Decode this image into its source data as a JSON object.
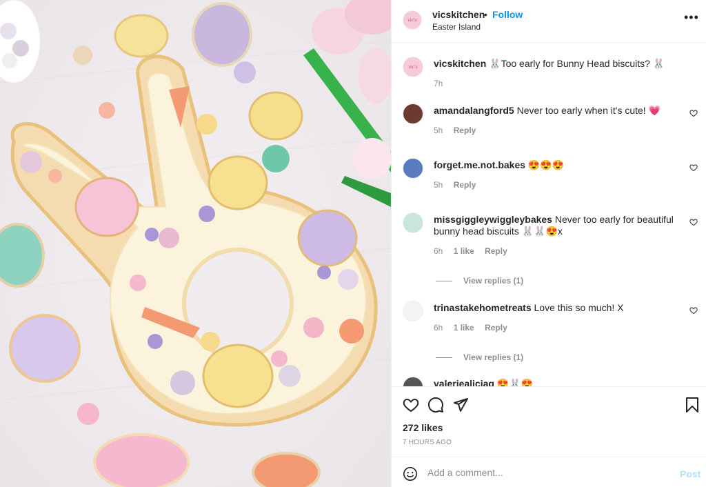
{
  "image": {
    "alt_description_icon": "bunny-cake-photo"
  },
  "header": {
    "username": "vicskitchen",
    "separator": "•",
    "follow_label": "Follow",
    "location": "Easter Island",
    "avatar_text": "vic's"
  },
  "caption": {
    "username": "vicskitchen",
    "text": "🐰Too early for Bunny Head biscuits? 🐰",
    "time": "7h"
  },
  "comments": [
    {
      "username": "amandalangford5",
      "text": "Never too early when it's cute! 💗",
      "time": "5h",
      "likes": "",
      "reply_label": "Reply"
    },
    {
      "username": "forget.me.not.bakes",
      "text": "😍😍😍",
      "time": "5h",
      "likes": "",
      "reply_label": "Reply"
    },
    {
      "username": "missgiggleywiggleybakes",
      "text": "Never too early for beautiful bunny head biscuits 🐰🐰😍x",
      "time": "6h",
      "likes": "1 like",
      "reply_label": "Reply",
      "view_replies": "View replies (1)"
    },
    {
      "username": "trinastakehometreats",
      "text": "Love this so much! X",
      "time": "6h",
      "likes": "1 like",
      "reply_label": "Reply",
      "view_replies": "View replies (1)"
    },
    {
      "username": "valeriealiciag",
      "text": "😍🐰😍",
      "time": "",
      "likes": "",
      "reply_label": ""
    }
  ],
  "actions": {
    "likes_count": "272 likes",
    "timestamp": "7 HOURS AGO"
  },
  "add_comment": {
    "placeholder": "Add a comment...",
    "post_label": "Post"
  },
  "colors": {
    "link_blue": "#0095f6",
    "post_disabled": "#b2dffc",
    "muted": "#8e8e8e",
    "text": "#262626",
    "heart_pink": "#ff5a8a"
  }
}
